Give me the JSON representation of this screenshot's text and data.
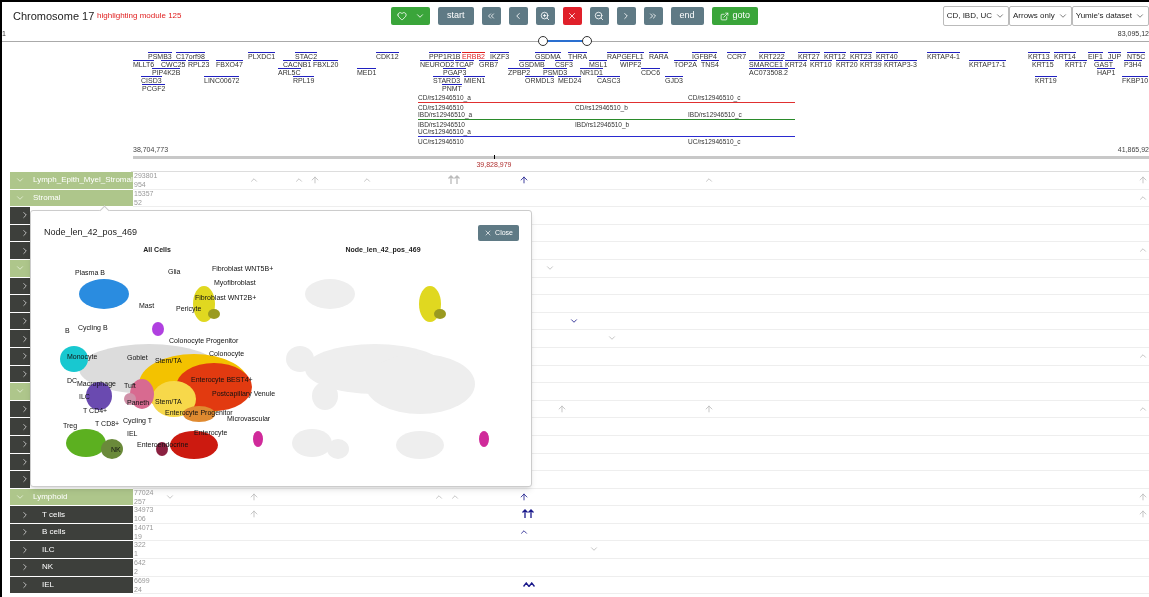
{
  "header": {
    "title": "Chromosome 17",
    "module_note": "highlighting module 125",
    "buttons": [
      {
        "kind": "favorite"
      },
      {
        "kind": "start",
        "label": "start"
      },
      {
        "kind": "rewind"
      },
      {
        "kind": "back"
      },
      {
        "kind": "zoom-in"
      },
      {
        "kind": "clear"
      },
      {
        "kind": "zoom-out"
      },
      {
        "kind": "forward"
      },
      {
        "kind": "fast-forward"
      },
      {
        "kind": "end",
        "label": "end"
      },
      {
        "kind": "goto",
        "label": "goto"
      }
    ],
    "selects": [
      {
        "value": "CD, IBD, UC"
      },
      {
        "value": "Arrows only"
      },
      {
        "value": "Yumie's dataset"
      }
    ]
  },
  "overview": {
    "start_label": "1",
    "end_label": "83,095,12",
    "thumbs": [
      {
        "level": 0.472
      },
      {
        "level": 0.51
      }
    ]
  },
  "genome": {
    "start_label": "38,704,773",
    "end_label": "41,865,92",
    "center_label": "39,828,979",
    "gene_rows": [
      [
        {
          "name": "PSMB3",
          "highlighted": false
        },
        {
          "name": "C17orf98",
          "highlighted": false
        },
        {
          "name": "PLXDC1",
          "highlighted": false
        },
        {
          "name": "STAC2",
          "highlighted": false
        },
        {
          "name": "CDK12",
          "highlighted": false
        },
        {
          "name": "PPP1R1B",
          "highlighted": false
        },
        {
          "name": "ERBB2",
          "highlighted": true
        },
        {
          "name": "IKZF3",
          "highlighted": false
        },
        {
          "name": "GSDMA",
          "highlighted": false
        },
        {
          "name": "THRA",
          "highlighted": false
        },
        {
          "name": "RAPGEFL1",
          "highlighted": false
        },
        {
          "name": "RARA",
          "highlighted": false
        },
        {
          "name": "IGFBP4",
          "highlighted": false
        },
        {
          "name": "CCR7",
          "highlighted": false
        },
        {
          "name": "KRT222",
          "highlighted": false
        },
        {
          "name": "KRT27",
          "highlighted": false
        },
        {
          "name": "KRT12",
          "highlighted": false
        },
        {
          "name": "KRT23",
          "highlighted": false
        },
        {
          "name": "KRT40",
          "highlighted": false
        },
        {
          "name": "KRTAP4-1",
          "highlighted": false
        },
        {
          "name": "KRT13",
          "highlighted": false
        },
        {
          "name": "KRT14",
          "highlighted": false
        },
        {
          "name": "EIF1",
          "highlighted": false
        },
        {
          "name": "JUP",
          "highlighted": false
        },
        {
          "name": "NT5C",
          "highlighted": false
        }
      ],
      [
        {
          "name": "MLLT6",
          "highlighted": false
        },
        {
          "name": "CWC25",
          "highlighted": false
        },
        {
          "name": "RPL23",
          "highlighted": false
        },
        {
          "name": "FBXO47",
          "highlighted": false
        },
        {
          "name": "CACNB1",
          "highlighted": false
        },
        {
          "name": "FBXL20",
          "highlighted": false
        },
        {
          "name": "NEUROD2",
          "highlighted": false
        },
        {
          "name": "TCAP",
          "highlighted": false
        },
        {
          "name": "GRB7",
          "highlighted": false
        },
        {
          "name": "GSDMB",
          "highlighted": false
        },
        {
          "name": "CSF3",
          "highlighted": false
        },
        {
          "name": "MSL1",
          "highlighted": false
        },
        {
          "name": "WIPF2",
          "highlighted": false
        },
        {
          "name": "TOP2A",
          "highlighted": false
        },
        {
          "name": "TNS4",
          "highlighted": false
        },
        {
          "name": "SMARCE1",
          "highlighted": false
        },
        {
          "name": "KRT24",
          "highlighted": false
        },
        {
          "name": "KRT10",
          "highlighted": false
        },
        {
          "name": "KRT20",
          "highlighted": false
        },
        {
          "name": "KRT39",
          "highlighted": false
        },
        {
          "name": "KRTAP3-3",
          "highlighted": false
        },
        {
          "name": "KRTAP17-1",
          "highlighted": false
        },
        {
          "name": "KRT15",
          "highlighted": false
        },
        {
          "name": "KRT17",
          "highlighted": false
        },
        {
          "name": "GAST",
          "highlighted": false
        },
        {
          "name": "P3H4",
          "highlighted": false
        }
      ],
      [
        {
          "name": "PIP4K2B",
          "highlighted": false
        },
        {
          "name": "ARL5C",
          "highlighted": false
        },
        {
          "name": "MED1",
          "highlighted": false
        },
        {
          "name": "PGAP3",
          "highlighted": false
        },
        {
          "name": "ZPBP2",
          "highlighted": false
        },
        {
          "name": "PSMD3",
          "highlighted": false
        },
        {
          "name": "NR1D1",
          "highlighted": false
        },
        {
          "name": "CDC6",
          "highlighted": false
        },
        {
          "name": "AC073508.2",
          "highlighted": false
        },
        {
          "name": "HAP1",
          "highlighted": false
        }
      ],
      [
        {
          "name": "CISD3",
          "highlighted": false
        },
        {
          "name": "LINC00672",
          "highlighted": false
        },
        {
          "name": "RPL19",
          "highlighted": false
        },
        {
          "name": "STARD3",
          "highlighted": false
        },
        {
          "name": "MIEN1",
          "highlighted": false
        },
        {
          "name": "ORMDL3",
          "highlighted": false
        },
        {
          "name": "MED24",
          "highlighted": false
        },
        {
          "name": "CASC3",
          "highlighted": false
        },
        {
          "name": "GJD3",
          "highlighted": false
        },
        {
          "name": "KRT19",
          "highlighted": false
        },
        {
          "name": "FKBP10",
          "highlighted": false
        }
      ],
      [
        {
          "name": "PCGF2",
          "highlighted": false
        },
        {
          "name": "PNMT",
          "highlighted": false
        }
      ]
    ],
    "variants": [
      {
        "color": "#e03030",
        "top_labels": [
          "CD/rs12946510_a",
          "CD/rs12946510_c"
        ],
        "bottom_labels": [
          "CD/rs12946510",
          "CD/rs12946510_b"
        ]
      },
      {
        "color": "#2a8a2a",
        "top_labels": [
          "IBD/rs12946510_a",
          "IBD/rs12946510_c"
        ],
        "bottom_labels": [
          "IBD/rs12946510",
          "IBD/rs12946510_b"
        ]
      },
      {
        "color": "#2a2ad0",
        "top_labels": [
          "UC/rs12946510_a"
        ],
        "bottom_labels": [
          "UC/rs12946510",
          "UC/rs12946510_c"
        ]
      }
    ]
  },
  "tracks": [
    {
      "label": "Lymph_Epith_Myel_Stromal",
      "expanded": true,
      "total": "293801",
      "count": "954",
      "markers": [
        {
          "kind": "caret-up",
          "highlighted": false
        },
        {
          "kind": "caret-up",
          "highlighted": false
        },
        {
          "kind": "arrow-up",
          "highlighted": false
        },
        {
          "kind": "caret-up",
          "highlighted": false
        },
        {
          "kind": "double-arrow",
          "highlighted": false
        },
        {
          "kind": "arrow-up",
          "highlighted": true
        },
        {
          "kind": "caret-up",
          "highlighted": false
        },
        {
          "kind": "arrow-up",
          "highlighted": false
        }
      ]
    },
    {
      "label": "Stromal",
      "expanded": true,
      "total": "15357",
      "count": "52",
      "markers": [
        {
          "kind": "caret-up",
          "highlighted": false
        }
      ]
    },
    {
      "expanded": false
    },
    {
      "expanded": false
    },
    {
      "expanded": false,
      "markers": [
        {
          "kind": "caret-up",
          "highlighted": false
        }
      ]
    },
    {
      "expanded": true,
      "markers": [
        {
          "kind": "caret-down",
          "highlighted": false
        }
      ]
    },
    {
      "expanded": false
    },
    {
      "expanded": false
    },
    {
      "expanded": false,
      "markers": [
        {
          "kind": "caret-down",
          "highlighted": true
        }
      ]
    },
    {
      "expanded": false,
      "markers": [
        {
          "kind": "caret-down",
          "highlighted": false
        }
      ]
    },
    {
      "expanded": false,
      "markers": [
        {
          "kind": "caret-up",
          "highlighted": false
        }
      ]
    },
    {
      "expanded": false
    },
    {
      "expanded": true
    },
    {
      "expanded": false,
      "markers": [
        {
          "kind": "arrow-up",
          "highlighted": false
        },
        {
          "kind": "arrow-up",
          "highlighted": false
        },
        {
          "kind": "caret-up",
          "highlighted": false
        }
      ]
    },
    {
      "expanded": false
    },
    {
      "expanded": false
    },
    {
      "expanded": false
    },
    {
      "expanded": false
    },
    {
      "label": "Lymphoid",
      "expanded": true,
      "total": "77024",
      "count": "257",
      "markers": [
        {
          "kind": "caret-down",
          "highlighted": false
        },
        {
          "kind": "arrow-up",
          "highlighted": false
        },
        {
          "kind": "caret-up",
          "highlighted": false
        },
        {
          "kind": "caret-up",
          "highlighted": false
        },
        {
          "kind": "arrow-up",
          "highlighted": true
        },
        {
          "kind": "arrow-up",
          "highlighted": false
        }
      ]
    },
    {
      "label": "T cells",
      "expanded": false,
      "total": "34973",
      "count": "106",
      "markers": [
        {
          "kind": "arrow-up",
          "highlighted": false
        },
        {
          "kind": "double-arrow",
          "highlighted": true
        },
        {
          "kind": "arrow-up",
          "highlighted": false
        }
      ]
    },
    {
      "label": "B cells",
      "expanded": false,
      "total": "14071",
      "count": "19",
      "markers": [
        {
          "kind": "caret-up",
          "highlighted": true
        }
      ]
    },
    {
      "label": "ILC",
      "expanded": false,
      "total": "322",
      "count": "1",
      "markers": [
        {
          "kind": "caret-down",
          "highlighted": false
        }
      ]
    },
    {
      "label": "NK",
      "expanded": false,
      "total": "642",
      "count": "2"
    },
    {
      "label": "IEL",
      "expanded": false,
      "total": "6699",
      "count": "24",
      "markers": [
        {
          "kind": "zigzag",
          "highlighted": true
        }
      ]
    }
  ],
  "popup": {
    "title": "Node_len_42_pos_469",
    "close_label": "Close",
    "panels": [
      {
        "kind": "all",
        "title": "All Cells",
        "labels": [
          "Plasma B",
          "Glia",
          "Fibroblast WNT5B+",
          "Myofibroblast",
          "Mast",
          "Fibroblast WNT2B+",
          "Pericyte",
          "B",
          "Cycling B",
          "Colonocyte Progenitor",
          "Colonocyte",
          "Goblet",
          "Stem/TA",
          "Monocyte",
          "DC",
          "Macrophage",
          "Enterocyte BEST4+",
          "Tuft",
          "ILC",
          "Postcapillary Venule",
          "Paneth",
          "Stem/TA",
          "T CD4+",
          "Enterocyte Progenitor",
          "Treg",
          "T CD8+",
          "Cycling T",
          "Microvascular",
          "IEL",
          "Enterocyte",
          "Enteroendocrine",
          "NK"
        ]
      },
      {
        "kind": "node",
        "title": "Node_len_42_pos_469"
      }
    ]
  }
}
